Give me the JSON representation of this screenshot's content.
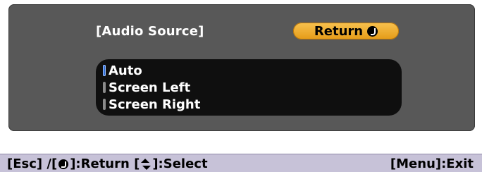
{
  "panel": {
    "title": "[Audio Source]",
    "return_button": {
      "label": "Return",
      "icon": "enter-icon"
    }
  },
  "options": [
    {
      "label": "Auto",
      "selected": true
    },
    {
      "label": "Screen Left",
      "selected": false
    },
    {
      "label": "Screen Right",
      "selected": false
    }
  ],
  "footer": {
    "left_parts": [
      "[Esc] /[",
      "]:Return  [",
      "]:Select"
    ],
    "left_icons": [
      "enter-icon",
      "up-down-icon"
    ],
    "right": "[Menu]:Exit"
  },
  "colors": {
    "panel_bg": "#585858",
    "list_bg": "#0f0f0f",
    "accent": "#f0ad2f",
    "selected_radio": "#2d6bd6",
    "footer_bg": "#c7c2d8"
  }
}
